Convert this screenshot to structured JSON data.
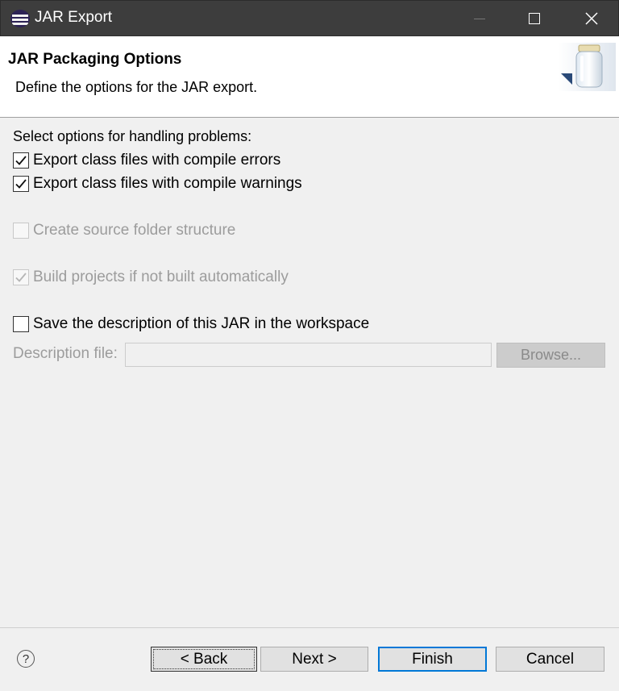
{
  "window": {
    "title": "JAR Export",
    "app_icon": "eclipse-icon",
    "controls": [
      "minimize-icon",
      "maximize-icon",
      "close-icon"
    ]
  },
  "header": {
    "title": "JAR Packaging Options",
    "description": "Define the options for the JAR export.",
    "banner_icon": "jar-icon"
  },
  "options": {
    "section_label": "Select options for handling problems:",
    "export_errors": {
      "label": "Export class files with compile errors",
      "checked": true,
      "enabled": true
    },
    "export_warnings": {
      "label": "Export class files with compile warnings",
      "checked": true,
      "enabled": true
    },
    "source_folder": {
      "label": "Create source folder structure",
      "checked": false,
      "enabled": false
    },
    "build_projects": {
      "label": "Build projects if not built automatically",
      "checked": true,
      "enabled": false
    },
    "save_description": {
      "label": "Save the description of this JAR in the workspace",
      "checked": false,
      "enabled": true
    }
  },
  "description_file": {
    "label": "Description file:",
    "value": "",
    "browse_label": "Browse..."
  },
  "footer": {
    "help_icon": "help-icon",
    "help_glyph": "?",
    "back_label": "< Back",
    "next_label": "Next >",
    "finish_label": "Finish",
    "cancel_label": "Cancel"
  },
  "colors": {
    "titlebar": "#3d3d3d",
    "dialog_bg": "#f0f0f0",
    "focus_border": "#0078d7",
    "disabled_text": "#9c9c9c"
  }
}
